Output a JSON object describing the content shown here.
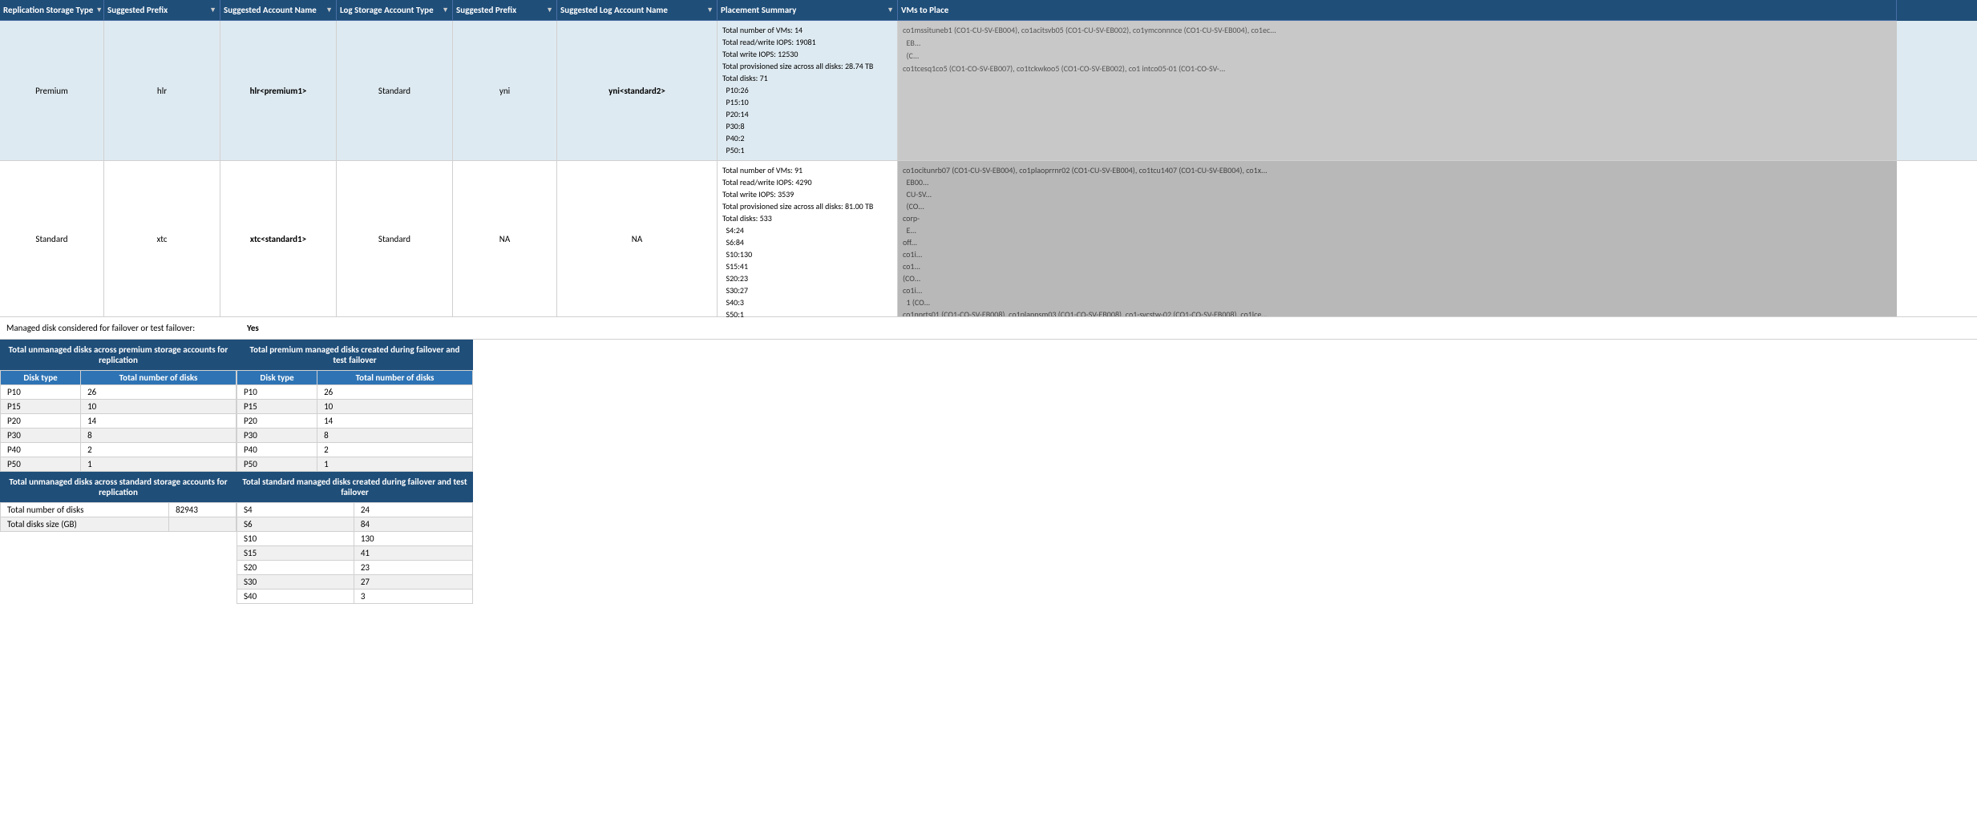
{
  "header": {
    "columns": [
      {
        "label": "Replication Storage Type",
        "key": "col-replication"
      },
      {
        "label": "Suggested Prefix",
        "key": "col-prefix"
      },
      {
        "label": "Suggested Account Name",
        "key": "col-account-name"
      },
      {
        "label": "Log Storage Account Type",
        "key": "col-log-storage"
      },
      {
        "label": "Suggested Prefix",
        "key": "col-log-prefix"
      },
      {
        "label": "Suggested Log Account  Name",
        "key": "col-log-account"
      },
      {
        "label": "Placement Summary",
        "key": "col-placement"
      },
      {
        "label": "VMs to Place",
        "key": "col-vms"
      }
    ]
  },
  "rows": [
    {
      "type": "premium",
      "replication": "Premium",
      "prefix": "hlr",
      "accountName": "hlr<premium1>",
      "logStorage": "Standard",
      "logPrefix": "yni",
      "logAccount": "yni<standard2>",
      "placement": "Total number of VMs: 14\nTotal read/write IOPS: 19081\nTotal write IOPS: 12530\nTotal provisioned size across all disks: 28.74 TB\nTotal disks: 71\n P10:26\n P15:10\n P20:14\n P30:8\n P40:2\n P50:1",
      "vms": "co1mssituneb1 (CO1-CU-SV-EB004), co1acitsvb05 (CO1-CU-SV-EB002), co1ymconnnce (CO1-CU-SV-EB004), co1ec...  EB... (C... co1tcesq1co5 (CO1-CO-SV-EB007), co1tckwkoo5 (CO1-CO-SV-EB002), co1 intco05-01 (CO1-CO-SV-..."
    },
    {
      "type": "standard",
      "replication": "Standard",
      "prefix": "xtc",
      "accountName": "xtc<standard1>",
      "logStorage": "Standard",
      "logPrefix": "NA",
      "logAccount": "NA",
      "placement": "Total number of VMs: 91\nTotal read/write IOPS: 4290\nTotal write IOPS: 3539\nTotal provisioned size across all disks: 81.00 TB\nTotal disks: 533\n S4:24\n S6:84\n S10:130\n S15:41\n S20:23\n S30:27\n S40:3\n S50:1",
      "vms": "co1ocitunrb07 (CO1-CU-SV-EB004), co1plaoprrnr02 (CO1-CU-SV-EB004), co1tcu1407 (CO1-CU-SV-EB004), co1x... EB00... CU-SV... (CO... corp- E... off... co1i... co1... (CO... co1i... 1 (CO..."
    }
  ],
  "managed_disk": {
    "label": "Managed disk considered for failover or test failover:",
    "value": "Yes"
  },
  "unmanaged_premium": {
    "title": "Total  unmanaged disks across premium storage accounts for replication",
    "columns": [
      "Disk type",
      "Total number of disks"
    ],
    "rows": [
      [
        "P10",
        "26"
      ],
      [
        "P15",
        "10"
      ],
      [
        "P20",
        "14"
      ],
      [
        "P30",
        "8"
      ],
      [
        "P40",
        "2"
      ],
      [
        "P50",
        "1"
      ]
    ]
  },
  "managed_premium": {
    "title": "Total premium managed disks created during failover and test failover",
    "columns": [
      "Disk type",
      "Total number of disks"
    ],
    "rows": [
      [
        "P10",
        "26"
      ],
      [
        "P15",
        "10"
      ],
      [
        "P20",
        "14"
      ],
      [
        "P30",
        "8"
      ],
      [
        "P40",
        "2"
      ],
      [
        "P50",
        "1"
      ]
    ]
  },
  "unmanaged_standard": {
    "title": "Total unmanaged disks across standard storage accounts for replication",
    "rows": [
      [
        "Total number of disks",
        "82943"
      ],
      [
        "Total disks size (GB)",
        ""
      ]
    ]
  },
  "managed_standard": {
    "title": "Total standard managed disks created during failover and test failover",
    "columns": [
      "",
      ""
    ],
    "rows": [
      [
        "S4",
        "24"
      ],
      [
        "S6",
        "84"
      ],
      [
        "S10",
        "130"
      ],
      [
        "S15",
        "41"
      ],
      [
        "S20",
        "23"
      ],
      [
        "S30",
        "27"
      ],
      [
        "S40",
        "3"
      ]
    ]
  }
}
